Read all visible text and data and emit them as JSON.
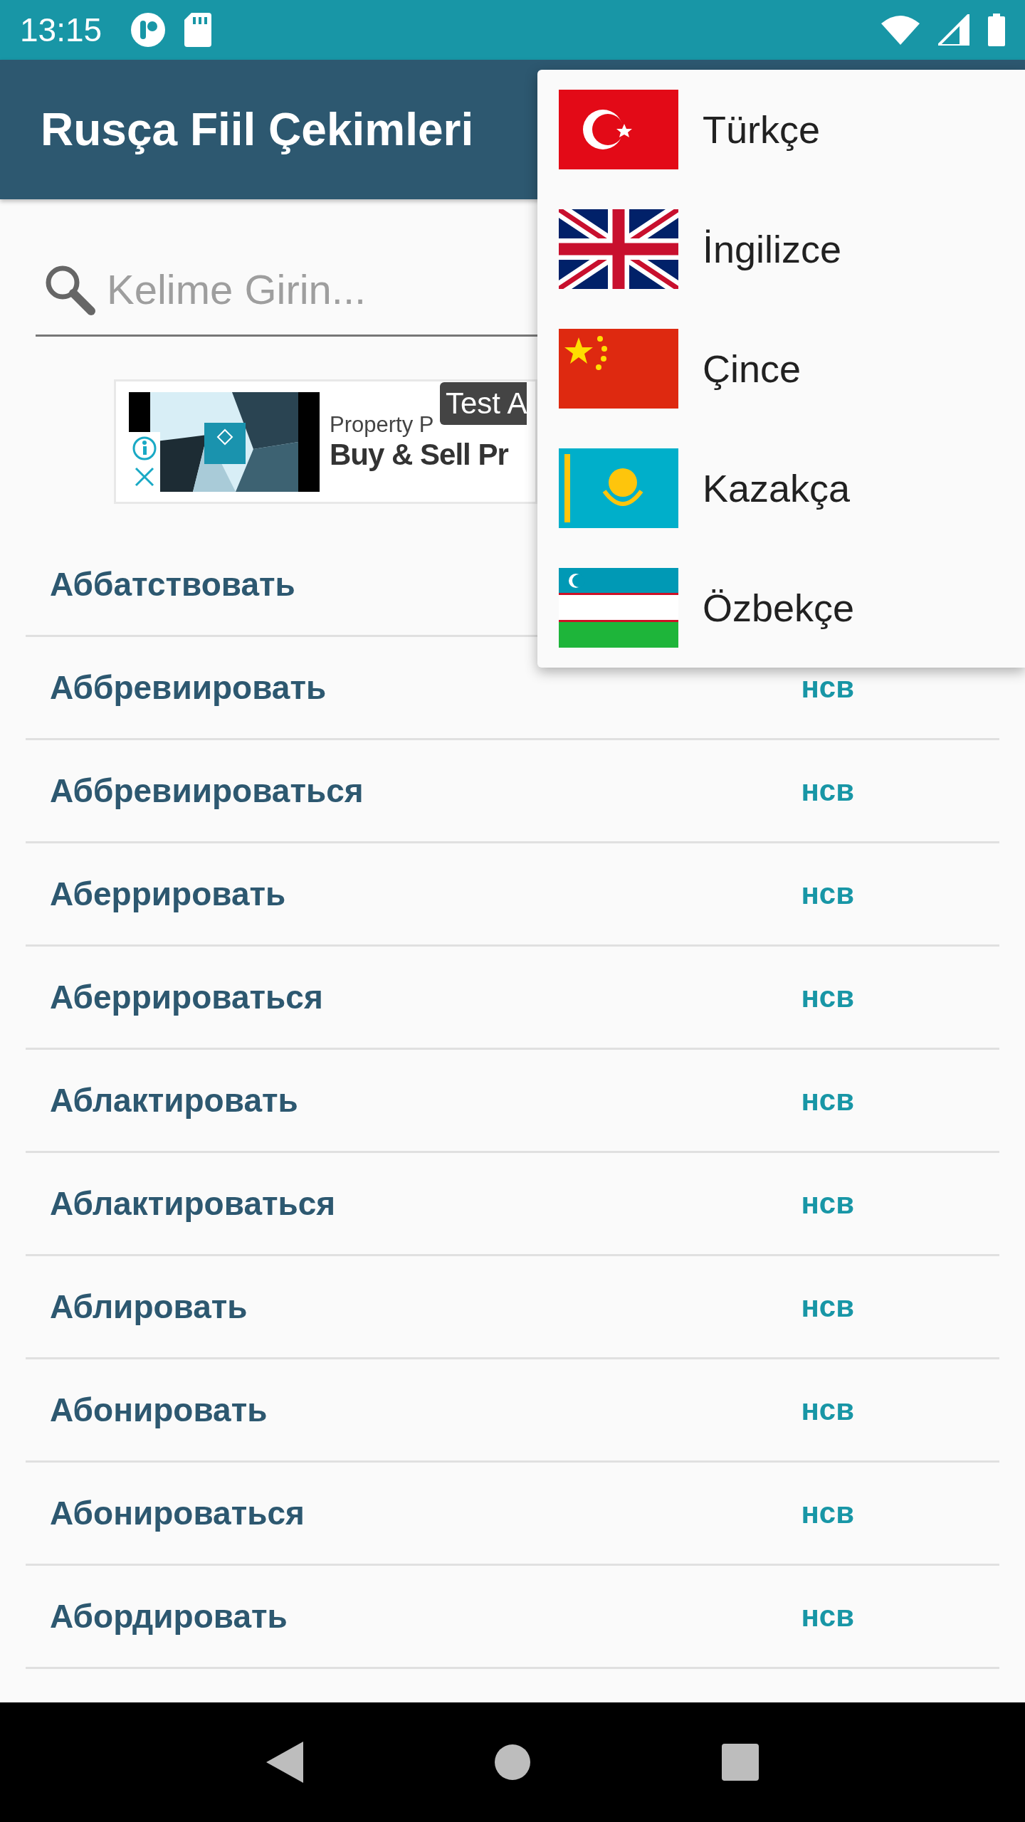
{
  "status_bar": {
    "time": "13:15"
  },
  "app_bar": {
    "title": "Rusça Fiil Çekimleri"
  },
  "search": {
    "placeholder": "Kelime Girin..."
  },
  "ad": {
    "badge": "Test A",
    "advertiser": "Property P",
    "headline": "Buy & Sell Pr"
  },
  "verbs": [
    {
      "word": "Аббатствовать"
    },
    {
      "word": "Аббревиировать",
      "aspect": "нсв"
    },
    {
      "word": "Аббревиироваться",
      "aspect": "нсв"
    },
    {
      "word": "Аберрировать",
      "aspect": "нсв"
    },
    {
      "word": "Аберрироваться",
      "aspect": "нсв"
    },
    {
      "word": "Аблактировать",
      "aspect": "нсв"
    },
    {
      "word": "Аблактироваться",
      "aspect": "нсв"
    },
    {
      "word": "Аблировать",
      "aspect": "нсв"
    },
    {
      "word": "Абонировать",
      "aspect": "нсв"
    },
    {
      "word": "Абонироваться",
      "aspect": "нсв"
    },
    {
      "word": "Абордировать",
      "aspect": "нсв"
    }
  ],
  "language_menu": {
    "items": [
      {
        "label": "Türkçe",
        "kind": "turkey"
      },
      {
        "label": "İngilizce",
        "kind": "uk"
      },
      {
        "label": "Çince",
        "kind": "china"
      },
      {
        "label": "Kazakça",
        "kind": "kazakhstan"
      },
      {
        "label": "Özbekçe",
        "kind": "uzbekistan"
      }
    ]
  }
}
